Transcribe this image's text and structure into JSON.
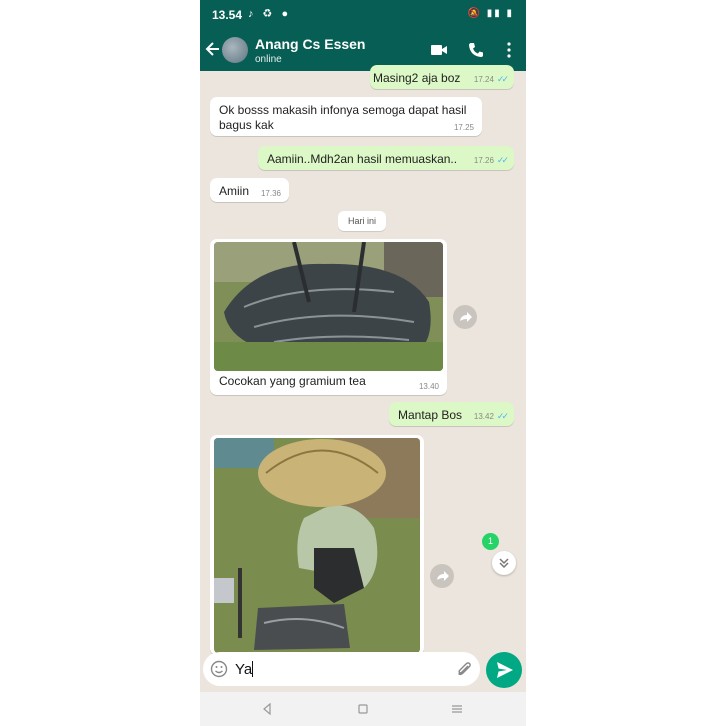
{
  "status_bar": {
    "time": "13.54"
  },
  "header": {
    "contact_name": "Anang Cs Essen",
    "status": "online"
  },
  "messages": [
    {
      "dir": "out",
      "text": "Masing2 aja boz",
      "time": "17.24"
    },
    {
      "dir": "in",
      "text_line1": "Ok bosss makasih infonya semoga dapat hasil",
      "text_line2": "bagus kak",
      "time": "17.25"
    },
    {
      "dir": "out",
      "text": "Aamiin..Mdh2an hasil memuaskan..",
      "time": "17.26"
    },
    {
      "dir": "in",
      "text": "Amiin",
      "time": "17.36"
    },
    {
      "dir": "in",
      "type": "image",
      "caption": "Cocokan yang gramium tea",
      "time": "13.40"
    },
    {
      "dir": "out",
      "text": "Mantap Bos",
      "time": "13.42"
    },
    {
      "dir": "in",
      "type": "image"
    }
  ],
  "date_separator": "Hari ini",
  "unread_badge": "1",
  "composer": {
    "text": "Ya"
  },
  "colors": {
    "header": "#075e54",
    "outgoing": "#dcf8c6",
    "send": "#00a884",
    "ticks": "#4fb6ec"
  }
}
